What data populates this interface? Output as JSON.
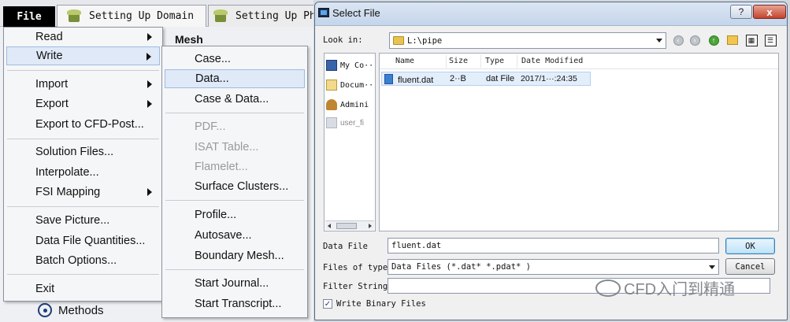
{
  "app": {
    "tabs": [
      {
        "label": "File"
      },
      {
        "label": "Setting Up Domain"
      },
      {
        "label": "Setting Up Phy"
      }
    ],
    "mesh_label": "Mesh",
    "methods_label": "Methods"
  },
  "file_menu": {
    "items": [
      {
        "label": "Read",
        "submenu": true
      },
      {
        "label": "Write",
        "submenu": true,
        "highlighted": true
      },
      {
        "label": "Import",
        "submenu": true
      },
      {
        "label": "Export",
        "submenu": true
      },
      {
        "label": "Export to CFD-Post..."
      },
      {
        "label": "Solution Files..."
      },
      {
        "label": "Interpolate..."
      },
      {
        "label": "FSI Mapping",
        "submenu": true
      },
      {
        "label": "Save Picture..."
      },
      {
        "label": "Data File Quantities..."
      },
      {
        "label": "Batch Options..."
      },
      {
        "label": "Exit"
      }
    ]
  },
  "write_menu": {
    "items": [
      {
        "label": "Case..."
      },
      {
        "label": "Data...",
        "highlighted": true
      },
      {
        "label": "Case & Data..."
      },
      {
        "label": "PDF...",
        "disabled": true
      },
      {
        "label": "ISAT Table...",
        "disabled": true
      },
      {
        "label": "Flamelet...",
        "disabled": true
      },
      {
        "label": "Surface Clusters..."
      },
      {
        "label": "Profile..."
      },
      {
        "label": "Autosave..."
      },
      {
        "label": "Boundary Mesh..."
      },
      {
        "label": "Start Journal..."
      },
      {
        "label": "Start Transcript..."
      }
    ]
  },
  "dialog": {
    "title": "Select File",
    "help_glyph": "?",
    "close_glyph": "x",
    "look_in_label": "Look in:",
    "look_in_value": "L:\\pipe",
    "sidebar": [
      {
        "label": "My Co··"
      },
      {
        "label": "Docum··"
      },
      {
        "label": "Admini"
      },
      {
        "label": "user_fi"
      }
    ],
    "columns": [
      "Name",
      "Size",
      "Type",
      "Date Modified"
    ],
    "files": [
      {
        "name": "fluent.dat",
        "size": "2··B",
        "type": "dat File",
        "modified": "2017/1···:24:35"
      }
    ],
    "data_file_label": "Data File",
    "data_file_value": "fluent.dat",
    "files_of_type_label": "Files of type:",
    "files_of_type_value": "Data Files (*.dat* *.pdat* )",
    "filter_label": "Filter String",
    "filter_value": "",
    "ok_label": "OK",
    "cancel_label": "Cancel",
    "checkbox_label": "Write Binary Files",
    "checkbox_checked": true,
    "watermark": "CFD入门到精通"
  }
}
